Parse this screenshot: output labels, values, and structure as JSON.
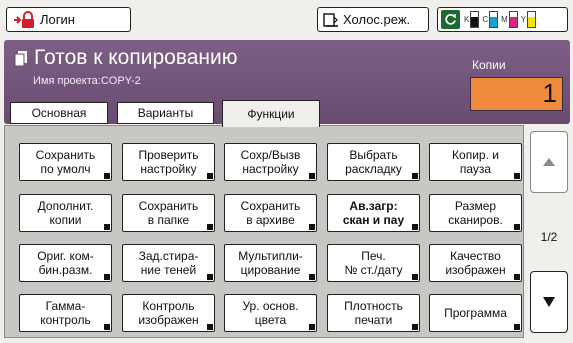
{
  "topbar": {
    "login_label": "Логин",
    "mono_label": "Холос.реж.",
    "inks": [
      {
        "label": "K",
        "color": "#111111",
        "level": 0.7
      },
      {
        "label": "C",
        "color": "#1aa0d8",
        "level": 0.7
      },
      {
        "label": "M",
        "color": "#d6267d",
        "level": 0.7
      },
      {
        "label": "Y",
        "color": "#f2e300",
        "level": 0.7
      }
    ]
  },
  "status": {
    "title": "Готов к копированию",
    "project": "Имя проекта:COPY-2",
    "copies_label": "Копии",
    "copies_value": "1"
  },
  "tabs": [
    "Основная",
    "Варианты",
    "Функции"
  ],
  "active_tab": "Функции",
  "functions": [
    [
      "Сохранить\nпо умолч",
      "Проверить\nнастройку",
      "Сохр/Вызв\nнастройку",
      "Выбрать\nраскладку",
      "Копир. и\nпауза"
    ],
    [
      "Дополнит.\nкопии",
      "Сохранить\nв папке",
      "Сохранить\nв архиве",
      "Ав.загр:\nскан и пау",
      "Размер\nсканиров."
    ],
    [
      "Ориг. ком-\nбин.разм.",
      "Зад.стира-\nние теней",
      "Мультипли-\nцирование",
      "Печ.\n№ ст./дату",
      "Качество\nизображен"
    ],
    [
      "Гамма-\nконтроль",
      "Контроль\nизображен",
      "Ур. основ.\nцвета",
      "Плотность\nпечати",
      "Программа"
    ]
  ],
  "bold_function": "Ав.загр:\nскан и пау",
  "pager": {
    "indicator": "1/2"
  }
}
